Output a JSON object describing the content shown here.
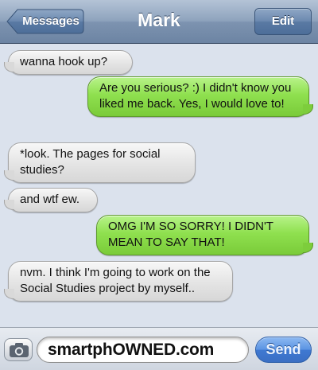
{
  "navbar": {
    "back_label": "Messages",
    "title": "Mark",
    "edit_label": "Edit"
  },
  "messages": [
    {
      "direction": "received",
      "text": "wanna hook up?"
    },
    {
      "direction": "sent",
      "text": "Are you serious? :) I didn't know you liked me back. Yes, I would love to!"
    },
    {
      "direction": "received",
      "text": "*look. The pages for social studies?"
    },
    {
      "direction": "received",
      "text": "and wtf ew."
    },
    {
      "direction": "sent",
      "text": "OMG I'M SO SORRY! I DIDN'T MEAN TO SAY THAT!"
    },
    {
      "direction": "received",
      "text": "nvm. I think I'm going to work on the Social Studies project by myself.."
    }
  ],
  "input": {
    "value": "smartphOWNED.com",
    "send_label": "Send",
    "camera_icon": "camera-icon"
  },
  "colors": {
    "sent_bubble": "#8fe04f",
    "received_bubble": "#e4e4e4",
    "navbar": "#7d93b0",
    "send_button": "#3f79d2",
    "background": "#dbe2ed"
  }
}
